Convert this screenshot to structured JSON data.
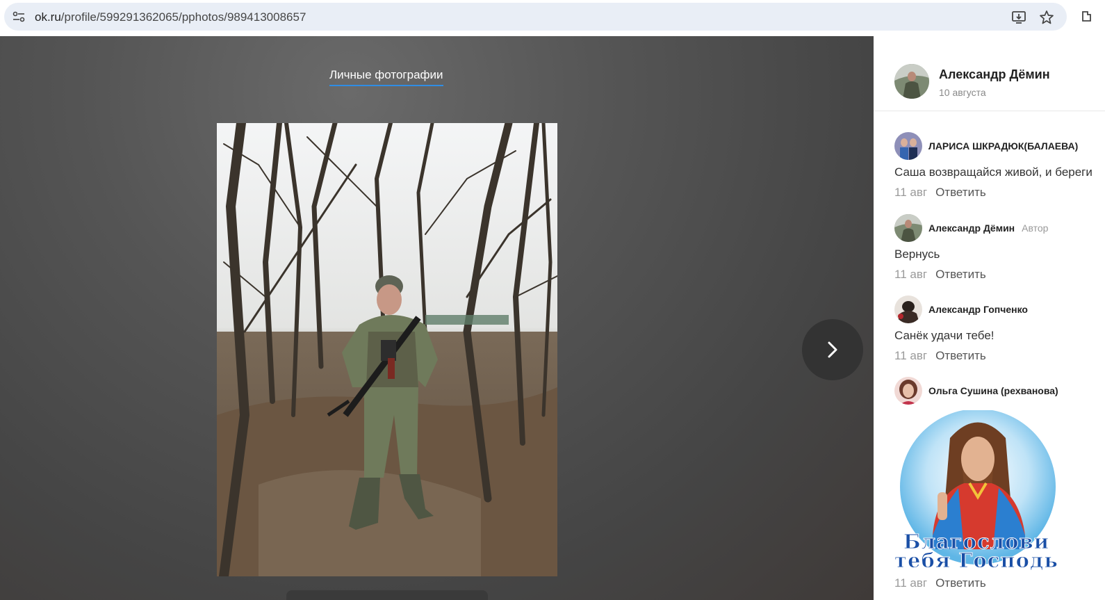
{
  "browser": {
    "url_host": "ok.ru",
    "url_path": "/profile/599291362065/pphotos/989413008657"
  },
  "viewer": {
    "album_title": "Личные фотографии"
  },
  "post": {
    "author": "Александр Дёмин",
    "date": "10 августа"
  },
  "comments": [
    {
      "name": "ЛАРИСА ШКРАДЮК(БАЛАЕВА)",
      "tag": "",
      "text": "Саша возвращайся живой, и береги",
      "date": "11 авг",
      "reply": "Ответить"
    },
    {
      "name": "Александр Дёмин",
      "tag": "Автор",
      "text": "Вернусь",
      "date": "11 авг",
      "reply": "Ответить"
    },
    {
      "name": "Александр Гопченко",
      "tag": "",
      "text": "Санёк удачи тебе!",
      "date": "11 авг",
      "reply": "Ответить"
    },
    {
      "name": "Ольга Сушина (рехванова)",
      "tag": "",
      "text": "",
      "date": "11 авг",
      "reply": "Ответить",
      "image_caption_line1": "Благослови",
      "image_caption_line2": "тебя Господь"
    }
  ],
  "colors": {
    "accent": "#2f8de4",
    "viewer_bg": "#505050"
  }
}
